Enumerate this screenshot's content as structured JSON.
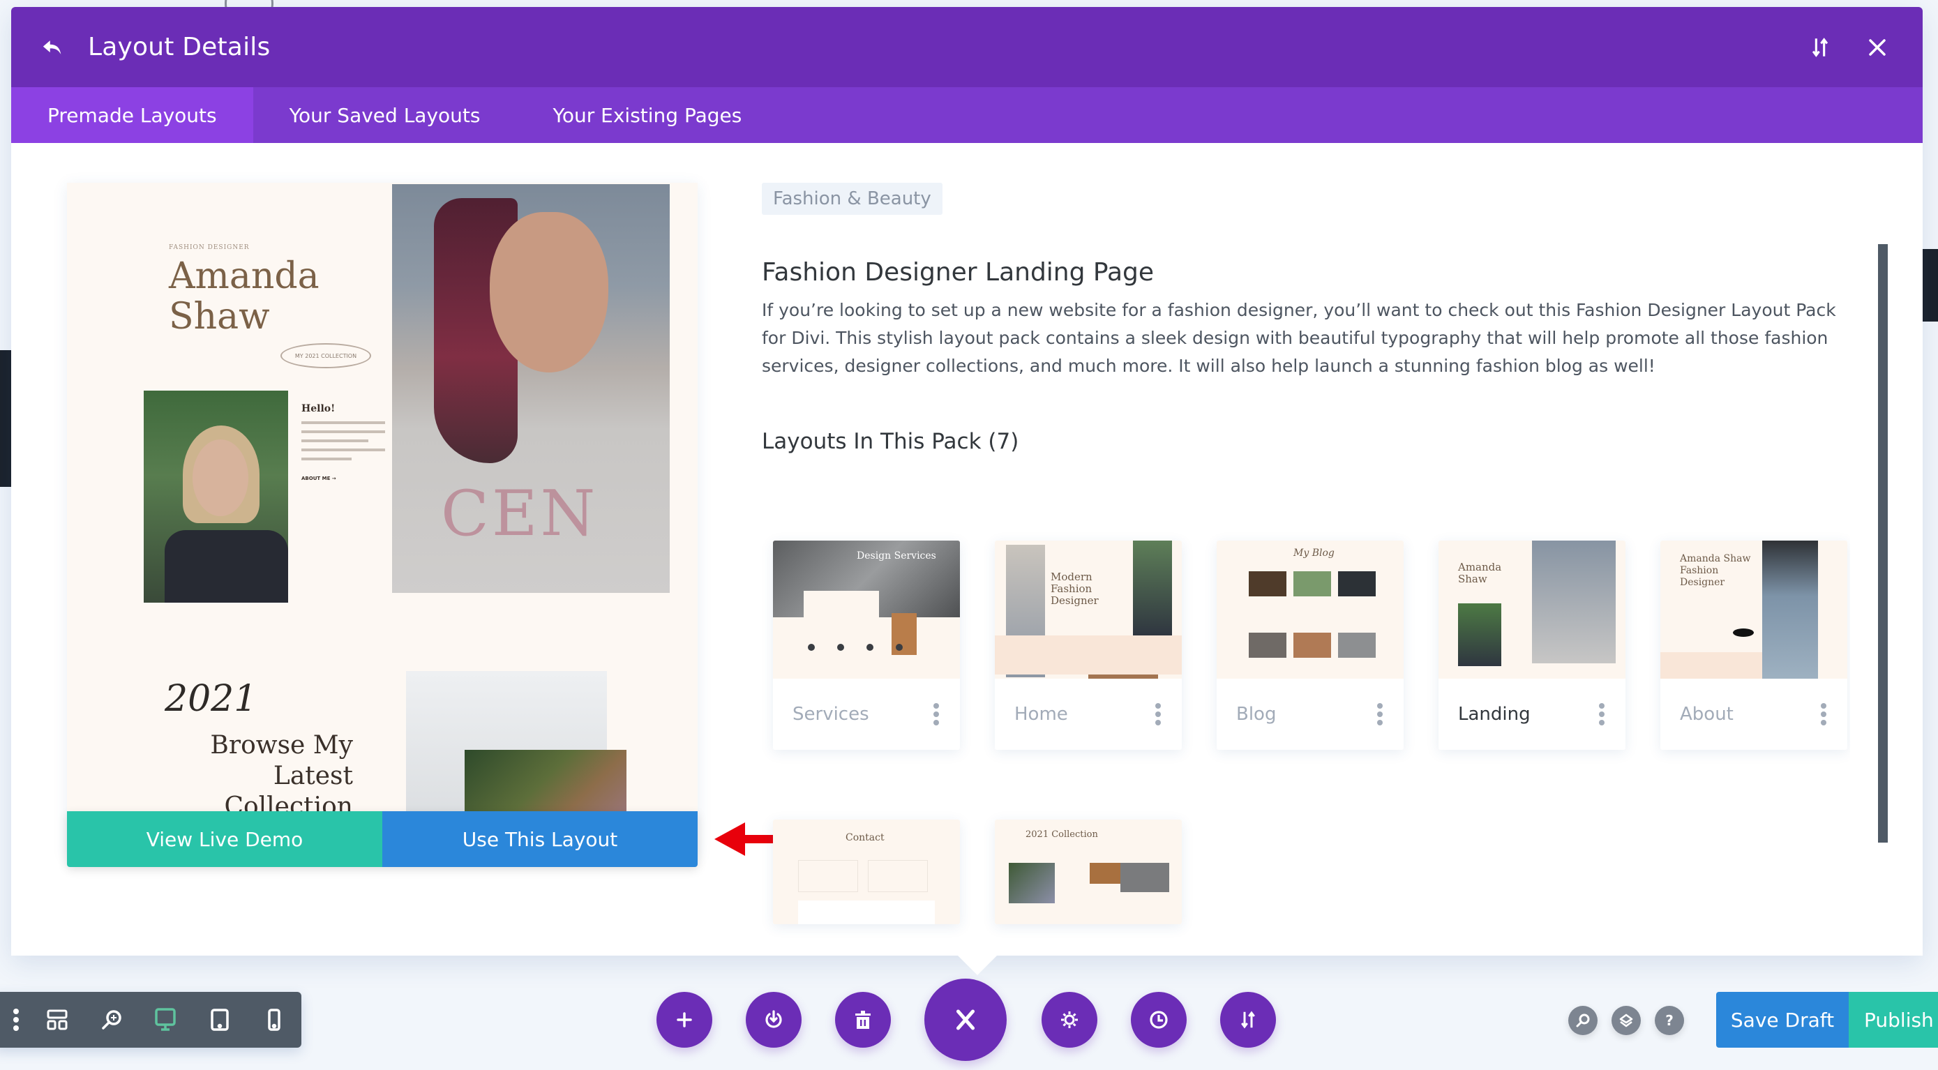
{
  "modal": {
    "title": "Layout Details",
    "back_icon": "back-arrow-icon",
    "sort_icon": "sort-arrows-icon",
    "close_icon": "close-icon"
  },
  "tabs": [
    {
      "label": "Premade Layouts",
      "active": true
    },
    {
      "label": "Your Saved Layouts",
      "active": false
    },
    {
      "label": "Your Existing Pages",
      "active": false
    }
  ],
  "preview": {
    "eyebrow": "FASHION DESIGNER",
    "name_line1": "Amanda",
    "name_line2": "Shaw",
    "pill": "MY 2021 COLLECTION",
    "hello": "Hello!",
    "about_link": "ABOUT ME →",
    "year": "2021",
    "browse_text": "Browse My Latest Collection",
    "shirt_text": "CEN",
    "view_demo_label": "View Live Demo",
    "use_layout_label": "Use This Layout"
  },
  "details": {
    "category": "Fashion & Beauty",
    "title": "Fashion Designer Landing Page",
    "description": "If you’re looking to set up a new website for a fashion designer, you’ll want to check out this Fashion Designer Layout Pack for Divi. This stylish layout pack contains a sleek design with beautiful typography that will help promote all those fashion services, designer collections, and much more. It will also help launch a stunning fashion blog as well!",
    "pack_heading": "Layouts In This Pack (7)",
    "layouts": [
      {
        "label": "Services",
        "thumb_title": "Design Services",
        "active": false
      },
      {
        "label": "Home",
        "thumb_title": "Modern Fashion Designer",
        "active": false
      },
      {
        "label": "Blog",
        "thumb_title": "My Blog",
        "active": false
      },
      {
        "label": "Landing",
        "thumb_title": "Amanda Shaw",
        "active": true
      },
      {
        "label": "About",
        "thumb_title": "Amanda Shaw Fashion Designer",
        "active": false
      },
      {
        "label": "Contact",
        "thumb_title": "Contact",
        "active": false
      },
      {
        "label": "2021 Collection",
        "thumb_title": "2021 Collection",
        "active": false
      }
    ]
  },
  "toolbar_left": {
    "items": [
      "more-icon",
      "wireframe-icon",
      "zoom-icon",
      "desktop-icon",
      "tablet-icon",
      "phone-icon"
    ],
    "active": "desktop-icon",
    "active_color": "#5fc39e"
  },
  "toolbar_center": {
    "items": [
      "add-icon",
      "power-icon",
      "trash-icon",
      "close-icon",
      "settings-icon",
      "history-icon",
      "sort-icon"
    ]
  },
  "toolbar_right": {
    "items": [
      "search-icon",
      "layers-icon",
      "help-icon"
    ],
    "save_draft_label": "Save Draft",
    "publish_label": "Publish"
  },
  "colors": {
    "header": "#6b2db6",
    "tabs": "#7b3ace",
    "tab_active": "#8c41e3",
    "teal": "#29c4a9",
    "blue": "#2b87da",
    "annotation_arrow": "#e8000b"
  }
}
